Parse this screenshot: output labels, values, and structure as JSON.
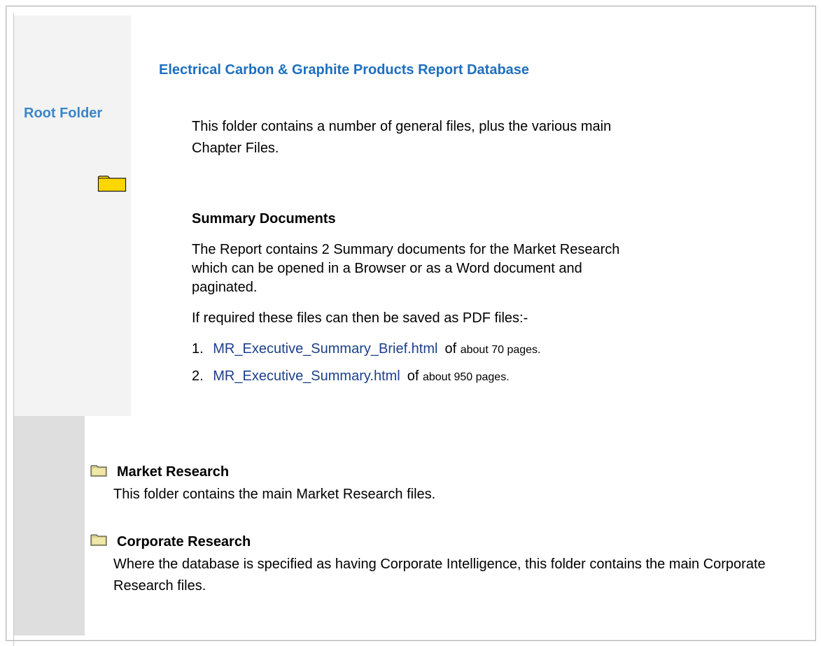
{
  "sidebar": {
    "root_label": "Root Folder"
  },
  "main": {
    "title": "Electrical Carbon & Graphite Products Report Database",
    "intro": "This folder contains a number of general files, plus the various main Chapter Files."
  },
  "summary": {
    "heading": "Summary Documents",
    "paragraph": "The Report contains 2 Summary documents for the Market Research which can be opened in a Browser or as a Word document and paginated.",
    "pdf_note": "If required these files can then be saved as PDF files:-",
    "files": [
      {
        "number": "1.",
        "name": "MR_Executive_Summary_Brief.html",
        "of": "of",
        "pages": "about 70 pages."
      },
      {
        "number": "2.",
        "name": "MR_Executive_Summary.html",
        "of": "of",
        "pages": "about 950 pages."
      }
    ]
  },
  "folders": [
    {
      "name": "Market Research",
      "description": "This folder contains the main Market Research files."
    },
    {
      "name": "Corporate Research",
      "description": "Where the database is specified as having Corporate Intelligence, this folder contains the main Corporate Research files."
    }
  ],
  "colors": {
    "root_label": "#3a86c8",
    "title": "#1e6fbf",
    "link": "#1c3f8c",
    "folder_yellow": "#ffd700",
    "folder_khaki": "#d8d08a"
  },
  "icons": [
    "folder-icon",
    "folder-icon-small"
  ]
}
